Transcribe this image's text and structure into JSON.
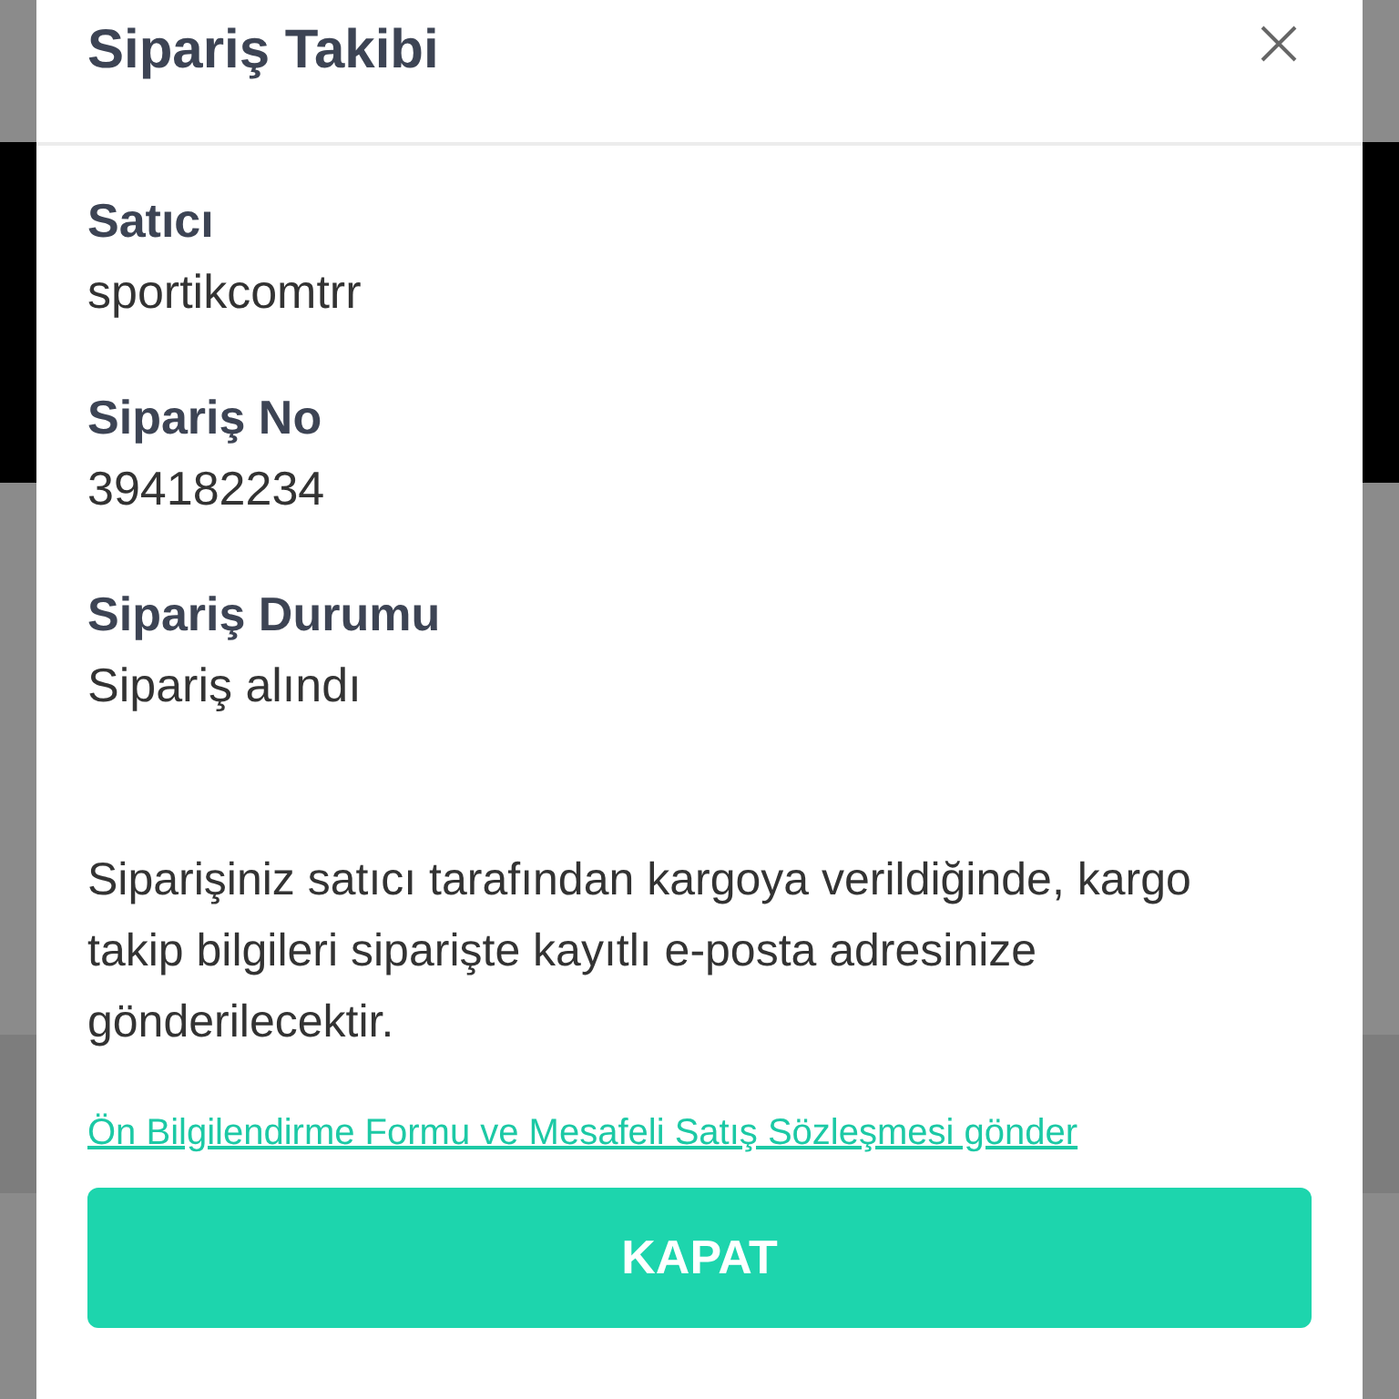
{
  "dialog": {
    "title": "Sipariş Takibi"
  },
  "fields": [
    {
      "label": "Satıcı",
      "value": "sportikcomtrr"
    },
    {
      "label": "Sipariş No",
      "value": "394182234"
    },
    {
      "label": "Sipariş Durumu",
      "value": "Sipariş alındı"
    }
  ],
  "message": "Siparişiniz satıcı tarafından kargoya verildiğinde, kargo takip bilgileri siparişte kayıtlı e-posta adresinize gönderilecektir.",
  "link": "Ön Bilgilendirme Formu ve Mesafeli Satış Sözleşmesi gönder",
  "button": "KAPAT"
}
